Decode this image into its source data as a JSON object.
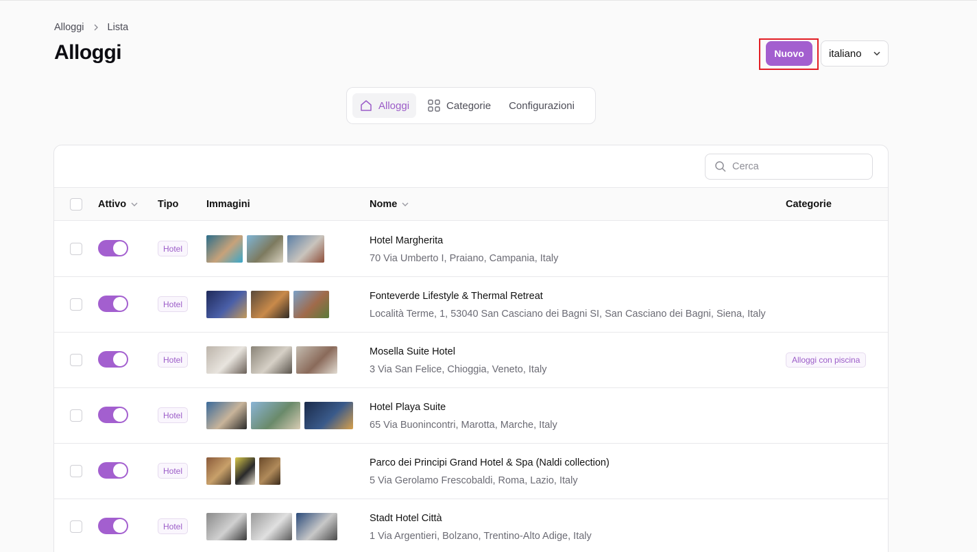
{
  "breadcrumb": {
    "root": "Alloggi",
    "current": "Lista"
  },
  "page_title": "Alloggi",
  "header": {
    "new_label": "Nuovo",
    "language": "italiano"
  },
  "tabs": [
    {
      "label": "Alloggi",
      "icon": "home-icon",
      "active": true
    },
    {
      "label": "Categorie",
      "icon": "grid-icon",
      "active": false
    },
    {
      "label": "Configurazioni",
      "icon": "",
      "active": false
    }
  ],
  "search": {
    "placeholder": "Cerca"
  },
  "table": {
    "columns": {
      "active": "Attivo",
      "type": "Tipo",
      "images": "Immagini",
      "name": "Nome",
      "categories": "Categorie"
    },
    "rows": [
      {
        "active": true,
        "type": "Hotel",
        "name": "Hotel Margherita",
        "address": "70 Via Umberto I, Praiano, Campania, Italy",
        "category": "",
        "images": [
          {
            "w": 53,
            "colors": [
              "#2c6e8a",
              "#c7a27a",
              "#3aa7c9"
            ]
          },
          {
            "w": 53,
            "colors": [
              "#7fb5d6",
              "#7d7a5f",
              "#d8d2c0"
            ]
          },
          {
            "w": 54,
            "colors": [
              "#5b7fa6",
              "#c9c4bd",
              "#8f4f3a"
            ]
          }
        ]
      },
      {
        "active": true,
        "type": "Hotel",
        "name": "Fonteverde Lifestyle & Thermal Retreat",
        "address": "Località Terme, 1, 53040 San Casciano dei Bagni SI, San Casciano dei Bagni, Siena, Italy",
        "category": "",
        "images": [
          {
            "w": 59,
            "colors": [
              "#1f2a5a",
              "#4a5fa8",
              "#c39a5a"
            ]
          },
          {
            "w": 56,
            "colors": [
              "#5a4a3a",
              "#c98a4a",
              "#2f2a24"
            ]
          },
          {
            "w": 52,
            "colors": [
              "#7aa0c8",
              "#a06a4a",
              "#5a7a3a"
            ]
          }
        ]
      },
      {
        "active": true,
        "type": "Hotel",
        "name": "Mosella Suite Hotel",
        "address": "3 Via San Felice, Chioggia, Veneto, Italy",
        "category": "Alloggi con piscina",
        "images": [
          {
            "w": 59,
            "colors": [
              "#bcb4aa",
              "#e8e4de",
              "#6a6058"
            ]
          },
          {
            "w": 60,
            "colors": [
              "#8a8478",
              "#d6d0c6",
              "#5a544c"
            ]
          },
          {
            "w": 60,
            "colors": [
              "#c4bcb0",
              "#8a6a5a",
              "#e2dcd2"
            ]
          }
        ]
      },
      {
        "active": true,
        "type": "Hotel",
        "name": "Hotel Playa Suite",
        "address": "65 Via Buonincontri, Marotta, Marche, Italy",
        "category": "",
        "images": [
          {
            "w": 59,
            "colors": [
              "#3a6a9a",
              "#c8b49a",
              "#2a2a2a"
            ]
          },
          {
            "w": 72,
            "colors": [
              "#8ab4d6",
              "#6a8a6a",
              "#d8ccb4"
            ]
          },
          {
            "w": 71,
            "colors": [
              "#1a2a4a",
              "#3a5a8a",
              "#d8a04a"
            ]
          }
        ]
      },
      {
        "active": true,
        "type": "Hotel",
        "name": "Parco dei Principi Grand Hotel & Spa (Naldi collection)",
        "address": "5 Via Gerolamo Frescobaldi, Roma, Lazio, Italy",
        "category": "",
        "images": [
          {
            "w": 36,
            "colors": [
              "#8a5a3a",
              "#c8a06a",
              "#4a3a2a"
            ]
          },
          {
            "w": 29,
            "colors": [
              "#d8c84a",
              "#2a2a2a",
              "#e8e0d0"
            ]
          },
          {
            "w": 31,
            "colors": [
              "#6a4a2a",
              "#b08a5a",
              "#3a2a1a"
            ]
          }
        ]
      },
      {
        "active": true,
        "type": "Hotel",
        "name": "Stadt Hotel Città",
        "address": "1 Via Argentieri, Bolzano, Trentino-Alto Adige, Italy",
        "category": "",
        "images": [
          {
            "w": 59,
            "colors": [
              "#8a8a8a",
              "#d0d0d0",
              "#3a3a3a"
            ]
          },
          {
            "w": 60,
            "colors": [
              "#9a9a9a",
              "#e0e0e0",
              "#5a5a5a"
            ]
          },
          {
            "w": 60,
            "colors": [
              "#2a4a7a",
              "#c8c8c8",
              "#4a4a4a"
            ]
          }
        ]
      }
    ]
  }
}
